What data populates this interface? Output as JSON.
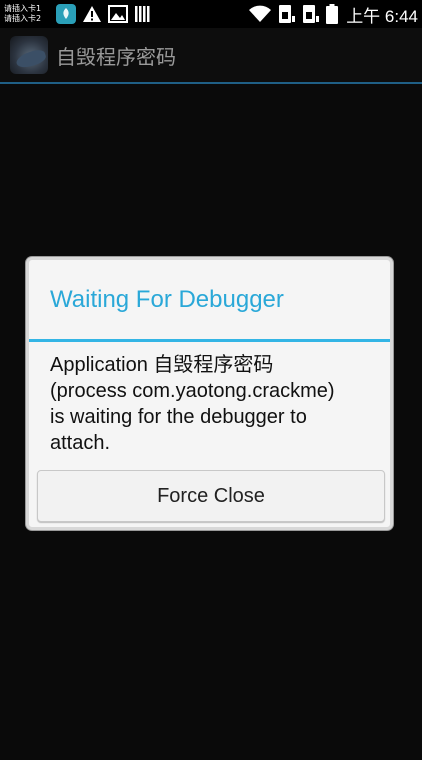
{
  "status_bar": {
    "sim_labels": [
      "请插入卡1",
      "请插入卡2"
    ],
    "time": "上午 6:44",
    "icons": [
      "huawei-app-icon",
      "warning-icon",
      "image-icon",
      "signal-bars-icon",
      "wifi-icon",
      "sim1-icon",
      "sim2-icon",
      "battery-icon"
    ]
  },
  "action_bar": {
    "title": "自毁程序密码"
  },
  "dialog": {
    "title": "Waiting For Debugger",
    "message_lines": [
      "Application 自毁程序密码",
      "(process com.yaotong.crackme)",
      "is waiting for the debugger to",
      "attach."
    ],
    "button_label": "Force Close"
  },
  "colors": {
    "accent": "#33b5e5",
    "title_text": "#2aa8d8",
    "background": "#0a0a0a"
  }
}
